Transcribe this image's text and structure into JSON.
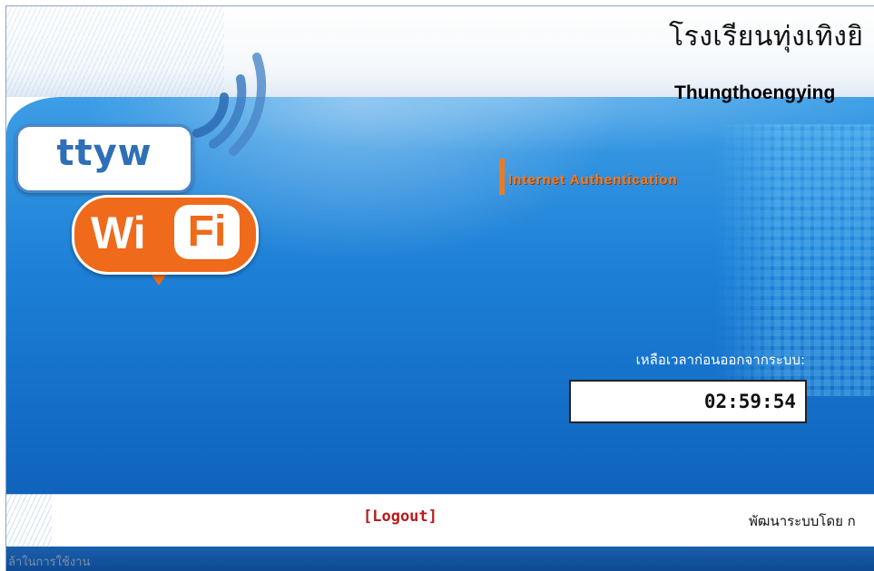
{
  "header": {
    "school_name_thai": "โรงเรียนทุ่งเทิงยิ",
    "school_name_en": "Thungthoengying"
  },
  "logo": {
    "ttyw_text": "ttyw",
    "wifi_wi": "Wi",
    "wifi_fi": "Fi"
  },
  "auth": {
    "title": "Internet Authentication"
  },
  "session": {
    "time_left_label": "เหลือเวลาก่อนออกจากระบบ:",
    "time_left_value": "02:59:54"
  },
  "footer": {
    "logout_label": "[Logout]",
    "developed_by": "พัฒนาระบบโดย ก",
    "bottom_text": "ล้าในการใช้งาน"
  },
  "colors": {
    "primary_blue": "#1c7fd6",
    "accent_orange": "#ef6a1a",
    "logout_red": "#b71c1c"
  }
}
